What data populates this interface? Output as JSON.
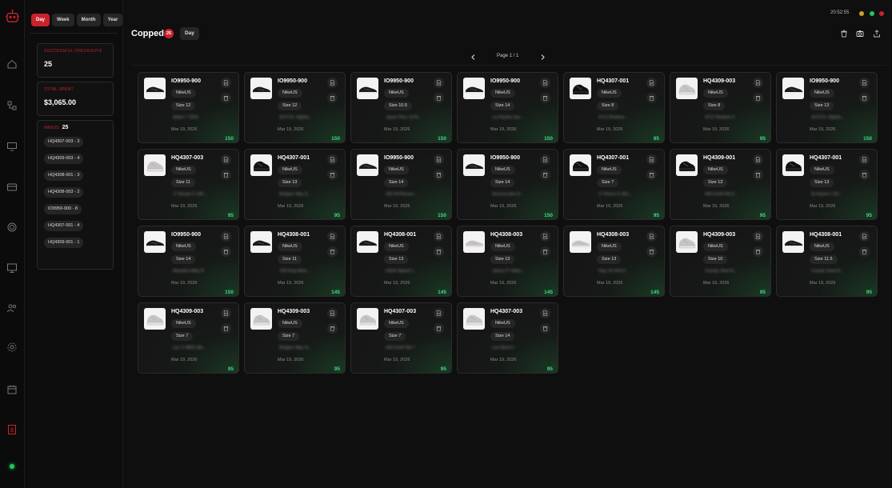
{
  "window": {
    "clock": "20:52:55",
    "dots": [
      "#c9a227",
      "#22c55e",
      "#c8232b"
    ]
  },
  "sidebar": {
    "icons": [
      "home-icon",
      "flow-icon",
      "monitor-settings-icon",
      "card-icon",
      "fingerprint-icon",
      "desktop-icon",
      "users-icon",
      "gear-icon",
      "calendar-icon",
      "dollar-icon"
    ],
    "status": "online"
  },
  "stats": {
    "ranges": [
      "Day",
      "Week",
      "Month",
      "Year"
    ],
    "active_range": "Day",
    "checkouts_label": "SUCCESSFUL CHECKOUTS",
    "checkouts_value": "25",
    "spent_label": "TOTAL SPENT",
    "spent_value": "$3,065.00",
    "skus_label": "NIKEUS",
    "skus_count": "25",
    "skus": [
      "HQ4307-003 - 3",
      "HQ4309-003 - 4",
      "HQ4308-001 - 3",
      "HQ4308-003 - 2",
      "IO9950-900 - 8",
      "HQ4307-001 - 4",
      "HQ4309-001 - 1"
    ]
  },
  "header": {
    "title": "Copped",
    "count": "25",
    "period": "Day",
    "page": "Page 1 / 1"
  },
  "cards": [
    {
      "sku": "IO9950-900",
      "store": "NikeUS",
      "size": "Size 12",
      "addr": "Adam 7 2001",
      "date": "Mar 19, 2026",
      "price": "150",
      "shoe": "dark-low"
    },
    {
      "sku": "IO9950-900",
      "store": "NikeUS",
      "size": "Size 12",
      "addr": "4273 N. Highla...",
      "date": "Mar 19, 2026",
      "price": "150",
      "shoe": "dark-low"
    },
    {
      "sku": "IO9950-900",
      "store": "NikeUS",
      "size": "Size 10.5",
      "addr": "Jayne Pine 14 R...",
      "date": "Mar 19, 2026",
      "price": "150",
      "shoe": "dark-low"
    },
    {
      "sku": "IO9950-900",
      "store": "NikeUS",
      "size": "Size 14",
      "addr": "La Paseta Jae...",
      "date": "Mar 19, 2026",
      "price": "150",
      "shoe": "dark-low"
    },
    {
      "sku": "HQ4307-001",
      "store": "NikeUS",
      "size": "Size 8",
      "addr": "4712 Redwer...",
      "date": "Mar 19, 2026",
      "price": "95",
      "shoe": "black-chunky"
    },
    {
      "sku": "HQ4309-003",
      "store": "NikeUS",
      "size": "Size 8",
      "addr": "4712 Redwer 5",
      "date": "Mar 19, 2026",
      "price": "95",
      "shoe": "grey-chunky"
    },
    {
      "sku": "IO9950-900",
      "store": "NikeUS",
      "size": "Size 13",
      "addr": "4273 N. Highla...",
      "date": "Mar 19, 2026",
      "price": "150",
      "shoe": "dark-low"
    },
    {
      "sku": "HQ4307-003",
      "store": "NikeUS",
      "size": "Size 11",
      "addr": "17 Broad S 105...",
      "date": "Mar 19, 2026",
      "price": "95",
      "shoe": "grey-chunky"
    },
    {
      "sku": "HQ4307-001",
      "store": "NikeUS",
      "size": "Size 13",
      "addr": "Belgian Way 5...",
      "date": "Mar 19, 2026",
      "price": "95",
      "shoe": "black-chunky"
    },
    {
      "sku": "IO9950-900",
      "store": "NikeUS",
      "size": "Size 14",
      "addr": "200 W Ransm...",
      "date": "Mar 19, 2026",
      "price": "150",
      "shoe": "dark-low"
    },
    {
      "sku": "IO9950-900",
      "store": "NikeUS",
      "size": "Size 14",
      "addr": "Genova Ave D...",
      "date": "Mar 19, 2026",
      "price": "150",
      "shoe": "dark-low"
    },
    {
      "sku": "HQ4307-001",
      "store": "NikeUS",
      "size": "Size 7",
      "addr": "17 Burns S 401...",
      "date": "Mar 19, 2026",
      "price": "95",
      "shoe": "black-chunky"
    },
    {
      "sku": "HQ4309-001",
      "store": "NikeUS",
      "size": "Size 13",
      "addr": "440 Forth Rd 5...",
      "date": "Mar 19, 2026",
      "price": "95",
      "shoe": "black-chunky"
    },
    {
      "sku": "HQ4307-001",
      "store": "NikeUS",
      "size": "Size 13",
      "addr": "5j Hearst 1 50...",
      "date": "Mar 19, 2026",
      "price": "95",
      "shoe": "black-chunky"
    },
    {
      "sku": "IO9950-900",
      "store": "NikeUS",
      "size": "Size 14",
      "addr": "Meadow Alley 8",
      "date": "Mar 19, 2026",
      "price": "150",
      "shoe": "dark-low"
    },
    {
      "sku": "HQ4308-001",
      "store": "NikeUS",
      "size": "Size 11",
      "addr": "700 King Blvd ...",
      "date": "Mar 19, 2026",
      "price": "145",
      "shoe": "dark-runner"
    },
    {
      "sku": "HQ4308-001",
      "store": "NikeUS",
      "size": "Size 13",
      "addr": "Infinit Signal 1...",
      "date": "Mar 19, 2026",
      "price": "145",
      "shoe": "dark-runner"
    },
    {
      "sku": "HQ4308-003",
      "store": "NikeUS",
      "size": "Size 13",
      "addr": "James P Valen...",
      "date": "Mar 19, 2026",
      "price": "145",
      "shoe": "grey-runner"
    },
    {
      "sku": "HQ4308-003",
      "store": "NikeUS",
      "size": "Size 13",
      "addr": "Hwy St Tent 9",
      "date": "Mar 19, 2026",
      "price": "145",
      "shoe": "grey-runner"
    },
    {
      "sku": "HQ4309-003",
      "store": "NikeUS",
      "size": "Size 10",
      "addr": "County Seat N...",
      "date": "Mar 19, 2026",
      "price": "95",
      "shoe": "grey-chunky"
    },
    {
      "sku": "HQ4308-001",
      "store": "NikeUS",
      "size": "Size 11.5",
      "addr": "County Seat N...",
      "date": "Mar 19, 2026",
      "price": "95",
      "shoe": "dark-runner"
    },
    {
      "sku": "HQ4309-003",
      "store": "NikeUS",
      "size": "Size 7",
      "addr": "Lac S 4850 4th...",
      "date": "Mar 19, 2026",
      "price": "95",
      "shoe": "grey-chunky"
    },
    {
      "sku": "HQ4309-003",
      "store": "NikeUS",
      "size": "Size 7",
      "addr": "Belgian Way S...",
      "date": "Mar 19, 2026",
      "price": "95",
      "shoe": "grey-chunky"
    },
    {
      "sku": "HQ4307-003",
      "store": "NikeUS",
      "size": "Size 7",
      "addr": "440 Forth Rd 7",
      "date": "Mar 19, 2026",
      "price": "95",
      "shoe": "grey-chunky"
    },
    {
      "sku": "HQ4307-003",
      "store": "NikeUS",
      "size": "Size 14",
      "addr": "Las Word 2",
      "date": "Mar 19, 2026",
      "price": "95",
      "shoe": "grey-chunky"
    }
  ]
}
